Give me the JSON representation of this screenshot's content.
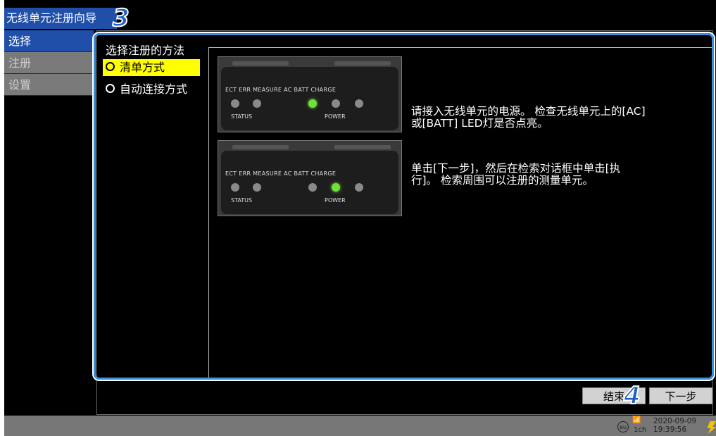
{
  "window_title": "无线单元注册向导",
  "nav": [
    "选择",
    "注册",
    "设置"
  ],
  "section_title": "选择注册的方法",
  "options": [
    {
      "label": "清单方式",
      "selected": true
    },
    {
      "label": "自动连接方式",
      "selected": false
    }
  ],
  "device": {
    "labels": "ECT  ERR  MEASURE    AC   BATT  CHARGE",
    "status_label": "STATUS",
    "power_label": "POWER"
  },
  "instructions": {
    "step1": "请接入无线单元的电源。 检查无线单元上的[AC]\n或[BATT] LED灯是否点亮。",
    "step2": "单击[下一步]，然后在检索对话框中单击[执\n行]。 检索周围可以注册的测量单元。"
  },
  "buttons": {
    "finish": "结束",
    "next": "下一步"
  },
  "callouts": {
    "three": "3",
    "four": "4"
  },
  "status": {
    "region": "eu",
    "channel": "1ch",
    "date": "2020-09-09",
    "time": "19:39:56"
  },
  "colors": {
    "accent": "#1f4fa8",
    "selected_bg": "#ffff00",
    "callout": "#3b8fdc",
    "led_on": "#6fe23a"
  }
}
